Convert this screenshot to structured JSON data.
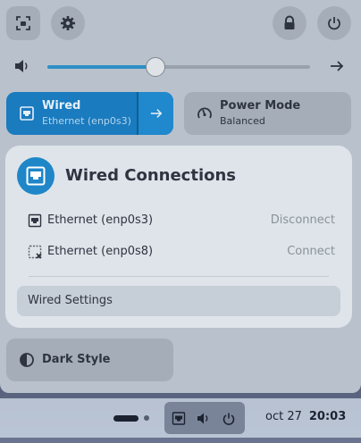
{
  "header": {
    "screenshot_icon": "screenshot-icon",
    "settings_icon": "gear-icon",
    "lock_icon": "lock-icon",
    "power_icon": "power-icon"
  },
  "volume": {
    "icon": "speaker-icon",
    "level": 0.41,
    "arrow_icon": "arrow-right-icon"
  },
  "tiles": {
    "wired": {
      "title": "Wired",
      "subtitle": "Ethernet (enp0s3)",
      "icon": "ethernet-icon"
    },
    "power_mode": {
      "title": "Power Mode",
      "subtitle": "Balanced",
      "icon": "gauge-icon"
    },
    "dark_style": {
      "title": "Dark Style",
      "icon": "contrast-icon"
    }
  },
  "popup": {
    "title": "Wired Connections",
    "connections": [
      {
        "name": "Ethernet (enp0s3)",
        "action": "Disconnect",
        "icon": "ethernet-icon"
      },
      {
        "name": "Ethernet (enp0s8)",
        "action": "Connect",
        "icon": "ethernet-disconnected-icon"
      }
    ],
    "settings_label": "Wired Settings"
  },
  "taskbar": {
    "date": "oct 27",
    "time": "20:03"
  },
  "colors": {
    "accent": "#1a7bbf",
    "panel": "#b9c2cc",
    "popup": "#dfe4ea"
  }
}
